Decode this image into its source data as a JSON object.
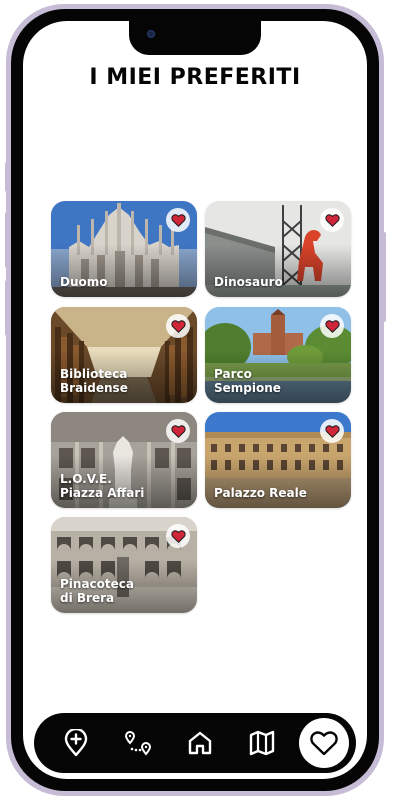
{
  "page": {
    "title": "I MIEI PREFERITI"
  },
  "favorites": [
    {
      "label": "Duomo",
      "image": "duomo-photo"
    },
    {
      "label": "Dinosauro",
      "image": "dinosaur-photo"
    },
    {
      "label": "Biblioteca\nBraidense",
      "image": "library-photo"
    },
    {
      "label": "Parco Sempione",
      "image": "park-photo"
    },
    {
      "label": "L.O.V.E.\nPiazza Affari",
      "image": "love-statue-photo"
    },
    {
      "label": "Palazzo Reale",
      "image": "palace-photo"
    },
    {
      "label": "Pinacoteca\ndi Brera",
      "image": "brera-photo"
    }
  ],
  "navbar": {
    "items": [
      "add-location-icon",
      "route-icon",
      "home-icon",
      "map-icon",
      "heart-icon"
    ],
    "active": "heart-icon"
  },
  "colors": {
    "heart": "#d0263a",
    "nav_background": "#050505",
    "accent_white": "#ffffff"
  }
}
